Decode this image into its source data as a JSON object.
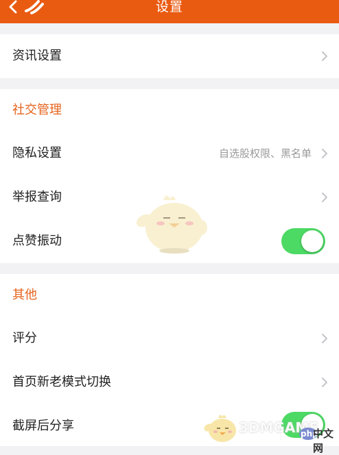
{
  "header": {
    "title": "设置"
  },
  "news": {
    "label": "资讯设置"
  },
  "social": {
    "title": "社交管理",
    "privacy": {
      "label": "隐私设置",
      "value": "自选股权限、黑名单"
    },
    "report": {
      "label": "举报查询"
    },
    "like_vibrate": {
      "label": "点赞振动",
      "on": true
    }
  },
  "other": {
    "title": "其他",
    "rate": {
      "label": "评分"
    },
    "home_mode": {
      "label": "首页新老模式切换"
    },
    "screenshot_share": {
      "label": "截屏后分享",
      "on": true
    }
  },
  "watermark": {
    "brand": "3DMGAME",
    "php": "php",
    "cn": "中文网"
  },
  "colors": {
    "nav": "#ea5b12",
    "section_title": "#e5621a",
    "toggle_on": "#4cd964",
    "background": "#f2f2f4"
  },
  "icons": {
    "back": "chevron-left-icon",
    "logo": "app-logo-icon",
    "disclosure": "chevron-right-icon"
  }
}
